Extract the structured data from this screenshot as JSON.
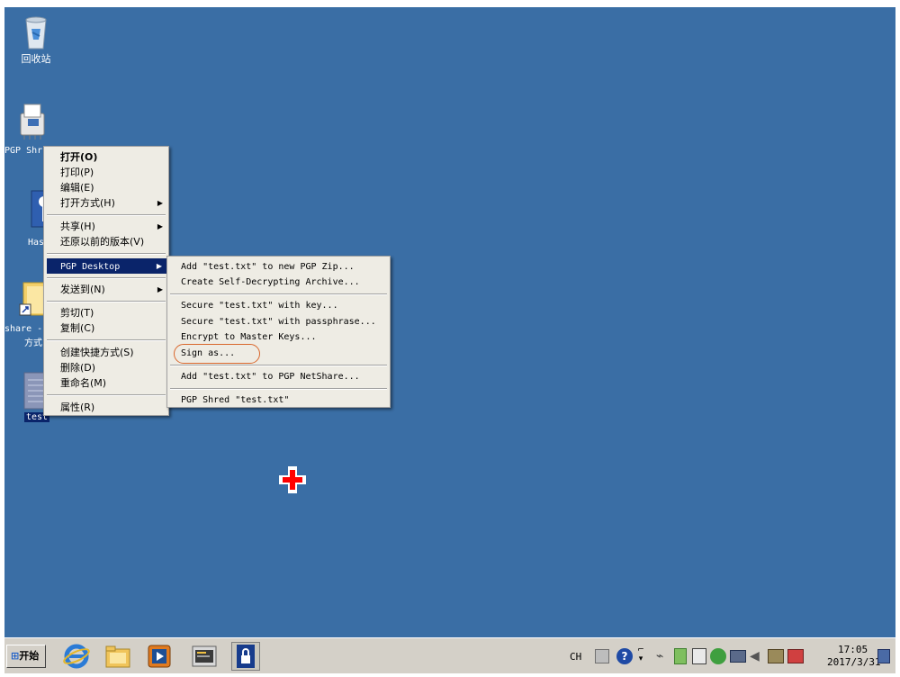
{
  "desktop": {
    "icons": {
      "recycle": "回收站",
      "pgp_shred": "PGP Shr",
      "hash": "Has",
      "share": "share -",
      "share_line2": "方式",
      "test": "test"
    }
  },
  "context_menu": {
    "items": [
      {
        "label": "打开(O)"
      },
      {
        "label": "打印(P)"
      },
      {
        "label": "编辑(E)"
      },
      {
        "label": "打开方式(H)"
      },
      {
        "label": "共享(H)"
      },
      {
        "label": "还原以前的版本(V)"
      },
      {
        "label": "PGP Desktop"
      },
      {
        "label": "发送到(N)"
      },
      {
        "label": "剪切(T)"
      },
      {
        "label": "复制(C)"
      },
      {
        "label": "创建快捷方式(S)"
      },
      {
        "label": "删除(D)"
      },
      {
        "label": "重命名(M)"
      },
      {
        "label": "属性(R)"
      }
    ]
  },
  "pgp_submenu": {
    "items": [
      {
        "label": "Add \"test.txt\" to new PGP Zip..."
      },
      {
        "label": "Create Self-Decrypting Archive..."
      },
      {
        "label": "Secure \"test.txt\" with key..."
      },
      {
        "label": "Secure \"test.txt\" with passphrase..."
      },
      {
        "label": "Encrypt to Master Keys..."
      },
      {
        "label": "Sign as..."
      },
      {
        "label": "Add \"test.txt\" to PGP NetShare..."
      },
      {
        "label": "PGP Shred \"test.txt\""
      }
    ]
  },
  "taskbar": {
    "start_label": "开始",
    "tray": {
      "lang": "CH",
      "time": "17:05",
      "date": "2017/3/31"
    }
  },
  "colors": {
    "desktop": "#3a6ea5",
    "menu_highlight": "#0a246a",
    "annotation_circle": "#d9672c",
    "cursor": "#ff0000"
  }
}
